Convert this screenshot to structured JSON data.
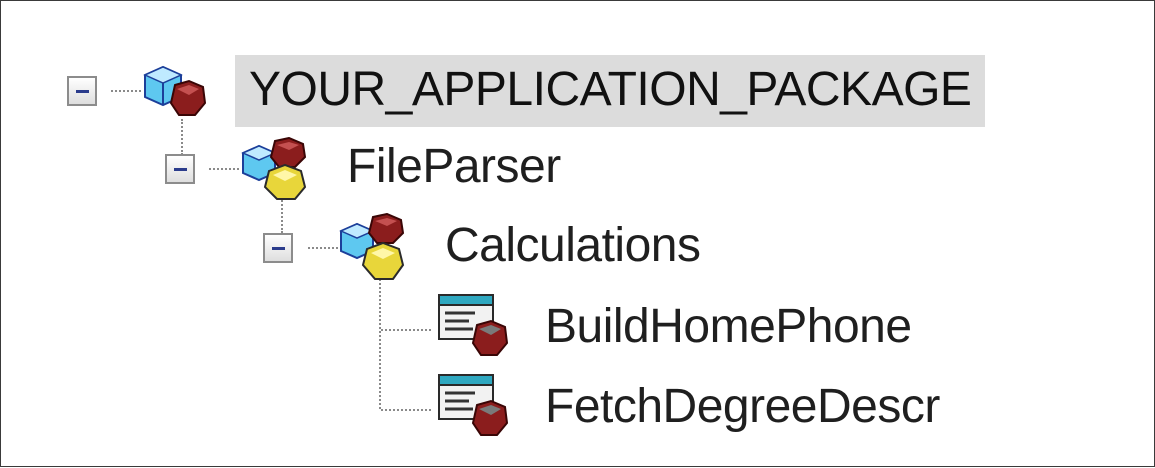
{
  "tree": {
    "root": {
      "label": "YOUR_APPLICATION_PACKAGE",
      "selected": true,
      "expanded": true,
      "icon": "application-package-icon",
      "children": [
        {
          "label": "FileParser",
          "expanded": true,
          "icon": "application-class-package-icon",
          "children": [
            {
              "label": "Calculations",
              "expanded": true,
              "icon": "application-class-package-icon",
              "children": [
                {
                  "label": "BuildHomePhone",
                  "icon": "application-class-icon"
                },
                {
                  "label": "FetchDegreeDescr",
                  "icon": "application-class-icon"
                }
              ]
            }
          ]
        }
      ]
    }
  },
  "colors": {
    "selection_bg": "#dcdcdc",
    "expander_minus": "#2b3c8c",
    "connector": "#8a8a8a"
  }
}
